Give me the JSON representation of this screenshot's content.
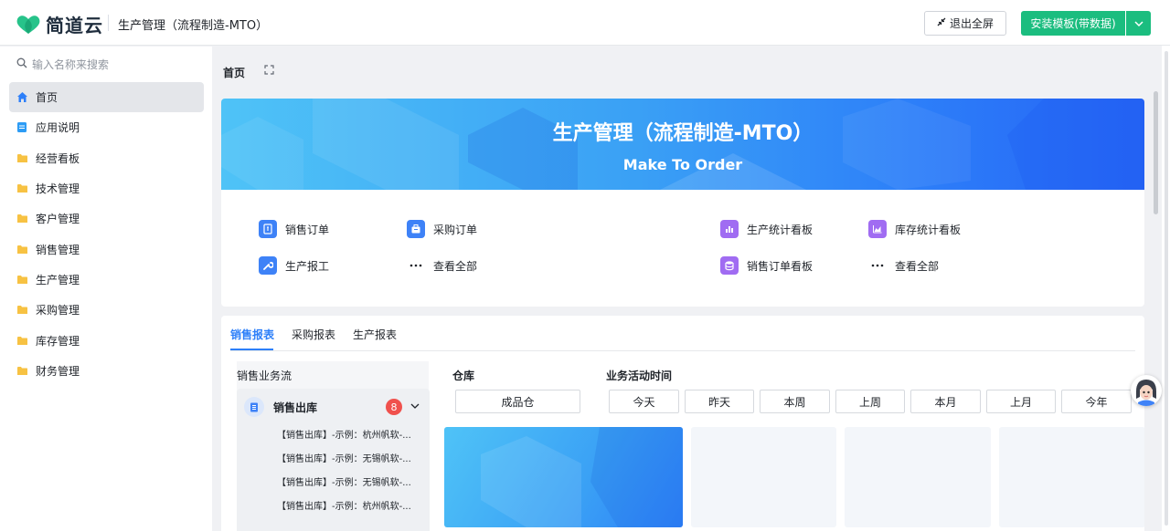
{
  "header": {
    "logo_text": "简道云",
    "app_title": "生产管理（流程制造-MTO）",
    "exit_fullscreen_label": "退出全屏",
    "install_label": "安装模板(带数据)",
    "brand_color": "#1bbd7f"
  },
  "sidebar": {
    "search_placeholder": "输入名称来搜索",
    "items": [
      {
        "label": "首页",
        "icon": "home-icon",
        "active": true
      },
      {
        "label": "应用说明",
        "icon": "doc-icon"
      },
      {
        "label": "经营看板",
        "icon": "folder-icon"
      },
      {
        "label": "技术管理",
        "icon": "folder-icon"
      },
      {
        "label": "客户管理",
        "icon": "folder-icon"
      },
      {
        "label": "销售管理",
        "icon": "folder-icon"
      },
      {
        "label": "生产管理",
        "icon": "folder-icon"
      },
      {
        "label": "采购管理",
        "icon": "folder-icon"
      },
      {
        "label": "库存管理",
        "icon": "folder-icon"
      },
      {
        "label": "财务管理",
        "icon": "folder-icon"
      }
    ]
  },
  "main": {
    "tab": "首页",
    "banner": {
      "title": "生产管理（流程制造-MTO）",
      "subtitle": "Make To Order"
    },
    "shortcuts_left": [
      {
        "label": "销售订单",
        "icon": "order-icon"
      },
      {
        "label": "采购订单",
        "icon": "briefcase-icon"
      },
      {
        "label": "生产报工",
        "icon": "wrench-icon"
      },
      {
        "label": "查看全部",
        "icon": "more-icon"
      }
    ],
    "shortcuts_right": [
      {
        "label": "生产统计看板",
        "icon": "bar-chart-icon"
      },
      {
        "label": "库存统计看板",
        "icon": "area-chart-icon"
      },
      {
        "label": "销售订单看板",
        "icon": "database-icon"
      },
      {
        "label": "查看全部",
        "icon": "more-icon"
      }
    ],
    "report_tabs": [
      "销售报表",
      "采购报表",
      "生产报表"
    ],
    "flow": {
      "title": "销售业务流",
      "card_title": "销售出库",
      "badge_count": "8",
      "rows": [
        "【销售出库】-示例：杭州帆软-...",
        "【销售出库】-示例：无锡帆软-...",
        "【销售出库】-示例：无锡帆软-...",
        "【销售出库】-示例：杭州帆软-..."
      ]
    },
    "warehouse": {
      "label": "仓库",
      "value": "成品仓"
    },
    "activity_time": {
      "label": "业务活动时间",
      "options": [
        "今天",
        "昨天",
        "本周",
        "上周",
        "本月",
        "上月",
        "今年"
      ]
    }
  }
}
